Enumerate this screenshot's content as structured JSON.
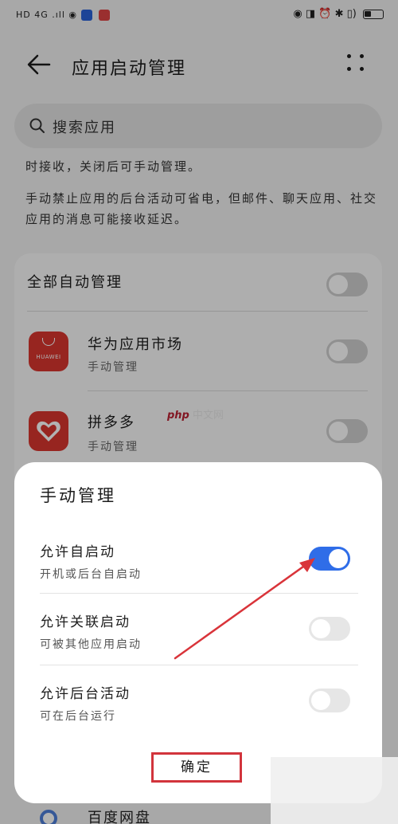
{
  "status_bar": {
    "left_text": "HD 4G .ıll ◉",
    "right_text": "◉ ◨ ⏰ ✱ ▯)"
  },
  "header": {
    "title": "应用启动管理"
  },
  "search": {
    "placeholder": "搜索应用"
  },
  "descriptions": {
    "line1": "时接收，关闭后可手动管理。",
    "line2": "手动禁止应用的后台活动可省电，但邮件、聊天应用、社交应用的消息可能接收延迟。"
  },
  "app_list": {
    "all_label": "全部自动管理",
    "items": [
      {
        "name": "华为应用市场",
        "status": "手动管理",
        "icon": "huawei-appgallery-icon",
        "brand": "HUAWEI"
      },
      {
        "name": "拼多多",
        "status": "手动管理",
        "icon": "pinduoduo-icon"
      }
    ],
    "partial_item": "百度网盘"
  },
  "watermark": {
    "php": "php",
    "site": "中文网"
  },
  "dialog": {
    "title": "手动管理",
    "options": [
      {
        "title": "允许自启动",
        "desc": "开机或后台自启动",
        "enabled": true
      },
      {
        "title": "允许关联启动",
        "desc": "可被其他应用启动",
        "enabled": false
      },
      {
        "title": "允许后台活动",
        "desc": "可在后台运行",
        "enabled": false
      }
    ],
    "confirm_label": "确定"
  },
  "colors": {
    "accent": "#2f6de8",
    "highlight_box": "#d2343c",
    "arrow": "#d9343a"
  }
}
